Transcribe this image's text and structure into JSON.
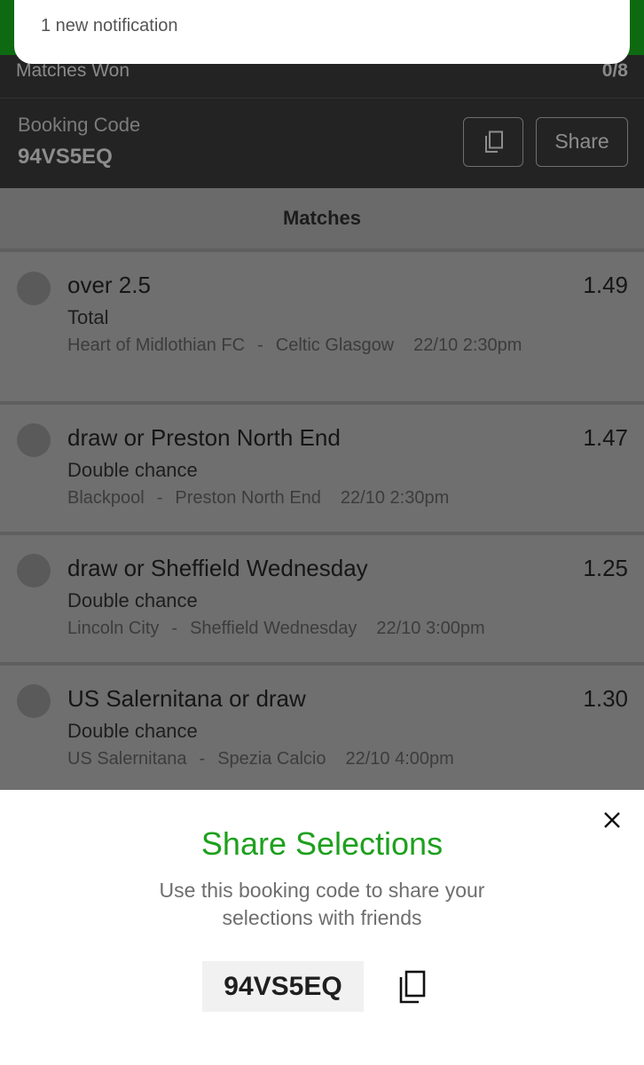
{
  "notification": {
    "text": "1 new notification"
  },
  "summary": {
    "matches_won_label": "Matches Won",
    "matches_won_value": "0/8",
    "booking_code_label": "Booking Code",
    "booking_code": "94VS5EQ",
    "share_label": "Share"
  },
  "matches_header": "Matches",
  "matches": [
    {
      "selection": "over 2.5",
      "odds": "1.49",
      "market": "Total",
      "home": "Heart of Midlothian FC",
      "away": "Celtic Glasgow",
      "datetime": "22/10 2:30pm"
    },
    {
      "selection": "draw or Preston North End",
      "odds": "1.47",
      "market": "Double chance",
      "home": "Blackpool",
      "away": "Preston North End",
      "datetime": "22/10 2:30pm"
    },
    {
      "selection": "draw or Sheffield Wednesday",
      "odds": "1.25",
      "market": "Double chance",
      "home": "Lincoln City",
      "away": "Sheffield Wednesday",
      "datetime": "22/10 3:00pm"
    },
    {
      "selection": "US Salernitana or draw",
      "odds": "1.30",
      "market": "Double chance",
      "home": "US Salernitana",
      "away": "Spezia Calcio",
      "datetime": "22/10 4:00pm"
    }
  ],
  "sheet": {
    "title": "Share Selections",
    "description": "Use this booking code to share your selections with friends",
    "code": "94VS5EQ"
  },
  "colors": {
    "brand_green": "#1ea01e",
    "overlay": "#6f6f6f",
    "dark_panel": "#232323"
  }
}
